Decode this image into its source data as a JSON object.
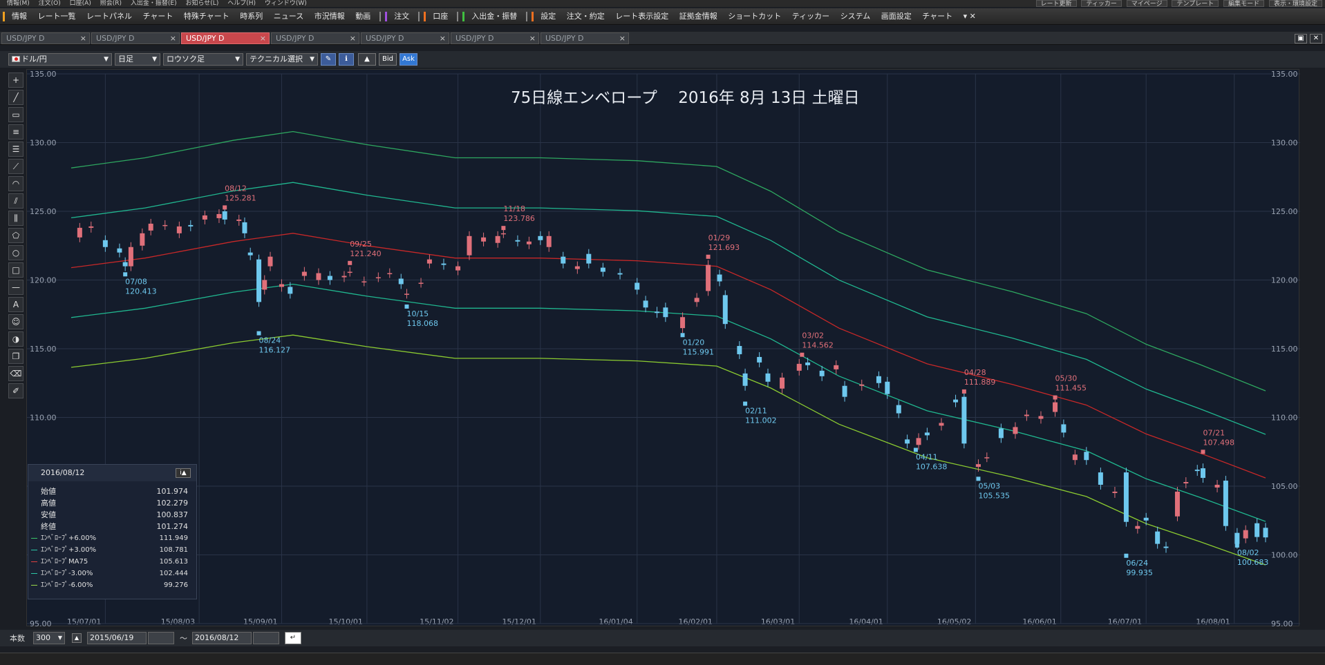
{
  "topbar": {
    "menu": [
      "情報(M)",
      "注文(O)",
      "口座(A)",
      "照会(R)",
      "入出金・振替(E)",
      "お知らせ(L)",
      "ヘルプ(H)",
      "ウィンドウ(W)"
    ],
    "right_buttons": [
      "レート更新",
      "ティッカー",
      "マイページ",
      "テンプレート",
      "編集モード",
      "表示・環境設定"
    ]
  },
  "menubar": {
    "items": [
      "情報",
      "レート一覧",
      "レートパネル",
      "チャート",
      "特殊チャート",
      "時系列",
      "ニュース",
      "市況情報",
      "動画",
      "注文",
      "口座",
      "入出金・振替",
      "設定",
      "注文・約定",
      "レート表示設定",
      "証拠金情報",
      "ショートカット",
      "ティッカー",
      "システム",
      "画面設定",
      "チャート"
    ],
    "overflow_icon": "▾ ✕"
  },
  "tabs": [
    {
      "label": "USD/JPY D",
      "active": false
    },
    {
      "label": "USD/JPY D",
      "active": false
    },
    {
      "label": "USD/JPY D",
      "active": true
    },
    {
      "label": "USD/JPY D",
      "active": false
    },
    {
      "label": "USD/JPY D",
      "active": false
    },
    {
      "label": "USD/JPY D",
      "active": false
    },
    {
      "label": "USD/JPY D",
      "active": false
    }
  ],
  "toolbar": {
    "pair": "ドル/円",
    "period": "日足",
    "chart_type": "ロウソク足",
    "technical": "テクニカル選択",
    "bid": "Bid",
    "ask": "Ask"
  },
  "left_tools": [
    "cursor-icon",
    "trendline-icon",
    "ruler-icon",
    "channel-icon",
    "fibonacci-icon",
    "fib-fan-icon",
    "fib-arc-icon",
    "gann-icon",
    "pitchfork-icon",
    "pentagon-icon",
    "circle-icon",
    "rectangle-icon",
    "hline-icon",
    "text-icon",
    "icon-icon",
    "paint-icon",
    "copy-icon",
    "eraser-icon",
    "settings-icon"
  ],
  "info_panel": {
    "date": "2016/08/12",
    "rows": [
      {
        "label": "始値",
        "value": "101.974"
      },
      {
        "label": "高値",
        "value": "102.279"
      },
      {
        "label": "安値",
        "value": "100.837"
      },
      {
        "label": "終値",
        "value": "101.274"
      },
      {
        "label": "ｴﾝﾍﾞﾛｰﾌﾟ+6.00%",
        "value": "111.949",
        "color": "#3ac86a"
      },
      {
        "label": "ｴﾝﾍﾞﾛｰﾌﾟ+3.00%",
        "value": "108.781",
        "color": "#2bc8a8"
      },
      {
        "label": "ｴﾝﾍﾞﾛｰﾌﾟMA75",
        "value": "105.613",
        "color": "#e04040"
      },
      {
        "label": "ｴﾝﾍﾞﾛｰﾌﾟ-3.00%",
        "value": "102.444",
        "color": "#2bc8a8"
      },
      {
        "label": "ｴﾝﾍﾞﾛｰﾌﾟ-6.00%",
        "value": "99.276",
        "color": "#9ad84a"
      }
    ]
  },
  "bottombar": {
    "count_label": "本数",
    "count": "300",
    "from": "2015/06/19",
    "tilde": "～",
    "to": "2016/08/12"
  },
  "colors": {
    "up": "#e0707a",
    "down": "#6ec8ee",
    "ma": "#c82828",
    "env3": "#20b890",
    "env6_up": "#2ea860",
    "env6_low": "#8ccc30"
  },
  "chart_data": {
    "type": "candlestick",
    "title": "75日線エンベロープ　 2016年 8月 13日 土曜日",
    "ylim": [
      95,
      135
    ],
    "yticks": [
      "135.00",
      "130.00",
      "125.00",
      "120.00",
      "115.00",
      "110.00",
      "105.00",
      "100.00",
      "95.00"
    ],
    "xticks": [
      "15/07/01",
      "15/08/03",
      "15/09/01",
      "15/10/01",
      "15/11/02",
      "15/12/01",
      "16/01/04",
      "16/02/01",
      "16/03/01",
      "16/04/01",
      "16/05/02",
      "16/06/01",
      "16/07/01",
      "16/08/01"
    ],
    "x_range": [
      "2015-06-19",
      "2016-08-12"
    ],
    "highs": [
      {
        "date": "08/12",
        "value": "125.281",
        "x": "2015-08-12",
        "y": 125.281
      },
      {
        "date": "09/25",
        "value": "121.240",
        "x": "2015-09-25",
        "y": 121.24
      },
      {
        "date": "11/18",
        "value": "123.786",
        "x": "2015-11-18",
        "y": 123.786
      },
      {
        "date": "01/29",
        "value": "121.693",
        "x": "2016-01-29",
        "y": 121.693
      },
      {
        "date": "03/02",
        "value": "114.562",
        "x": "2016-03-02",
        "y": 114.562
      },
      {
        "date": "04/28",
        "value": "111.889",
        "x": "2016-04-28",
        "y": 111.889
      },
      {
        "date": "05/30",
        "value": "111.455",
        "x": "2016-05-30",
        "y": 111.455
      },
      {
        "date": "07/21",
        "value": "107.498",
        "x": "2016-07-21",
        "y": 107.498
      }
    ],
    "lows": [
      {
        "date": "07/08",
        "value": "120.413",
        "x": "2015-07-08",
        "y": 120.413
      },
      {
        "date": "08/24",
        "value": "116.127",
        "x": "2015-08-24",
        "y": 116.127
      },
      {
        "date": "10/15",
        "value": "118.068",
        "x": "2015-10-15",
        "y": 118.068
      },
      {
        "date": "01/20",
        "value": "115.991",
        "x": "2016-01-20",
        "y": 115.991
      },
      {
        "date": "02/11",
        "value": "111.002",
        "x": "2016-02-11",
        "y": 111.002
      },
      {
        "date": "04/11",
        "value": "107.638",
        "x": "2016-04-11",
        "y": 107.638
      },
      {
        "date": "05/03",
        "value": "105.535",
        "x": "2016-05-03",
        "y": 105.535
      },
      {
        "date": "06/24",
        "value": "99.935",
        "x": "2016-06-24",
        "y": 99.935
      },
      {
        "date": "08/02",
        "value": "100.683",
        "x": "2016-08-02",
        "y": 100.683
      }
    ],
    "ma75": [
      [
        "2015-06-19",
        120.9
      ],
      [
        "2015-07-15",
        121.6
      ],
      [
        "2015-08-15",
        122.8
      ],
      [
        "2015-09-05",
        123.4
      ],
      [
        "2015-10-01",
        122.5
      ],
      [
        "2015-11-01",
        121.6
      ],
      [
        "2015-12-01",
        121.6
      ],
      [
        "2016-01-04",
        121.4
      ],
      [
        "2016-02-01",
        121.0
      ],
      [
        "2016-02-20",
        119.3
      ],
      [
        "2016-03-15",
        116.5
      ],
      [
        "2016-04-15",
        113.9
      ],
      [
        "2016-05-15",
        112.4
      ],
      [
        "2016-06-10",
        110.9
      ],
      [
        "2016-07-01",
        108.8
      ],
      [
        "2016-07-20",
        107.4
      ],
      [
        "2016-08-12",
        105.6
      ]
    ],
    "series": [
      {
        "name": "ｴﾝﾍﾞﾛｰﾌﾟ+6.00%",
        "factor": 1.06
      },
      {
        "name": "ｴﾝﾍﾞﾛｰﾌﾟ+3.00%",
        "factor": 1.03
      },
      {
        "name": "ｴﾝﾍﾞﾛｰﾌﾟMA75",
        "factor": 1.0
      },
      {
        "name": "ｴﾝﾍﾞﾛｰﾌﾟ-3.00%",
        "factor": 0.97
      },
      {
        "name": "ｴﾝﾍﾞﾛｰﾌﾟ-6.00%",
        "factor": 0.94
      }
    ],
    "candles": [
      [
        "2015-06-22",
        123.1,
        123.8
      ],
      [
        "2015-06-26",
        123.8,
        123.9
      ],
      [
        "2015-07-01",
        122.9,
        122.4
      ],
      [
        "2015-07-06",
        122.3,
        122.0
      ],
      [
        "2015-07-08",
        121.3,
        121.0
      ],
      [
        "2015-07-10",
        121.0,
        122.4
      ],
      [
        "2015-07-14",
        122.5,
        123.4
      ],
      [
        "2015-07-17",
        123.6,
        124.1
      ],
      [
        "2015-07-22",
        124.0,
        124.0
      ],
      [
        "2015-07-27",
        123.4,
        123.9
      ],
      [
        "2015-07-31",
        124.0,
        123.9
      ],
      [
        "2015-08-05",
        124.4,
        124.7
      ],
      [
        "2015-08-10",
        124.5,
        124.8
      ],
      [
        "2015-08-12",
        125.0,
        124.4
      ],
      [
        "2015-08-17",
        124.3,
        124.4
      ],
      [
        "2015-08-19",
        124.2,
        123.4
      ],
      [
        "2015-08-21",
        122.0,
        121.8
      ],
      [
        "2015-08-24",
        121.5,
        118.4
      ],
      [
        "2015-08-26",
        119.3,
        120.0
      ],
      [
        "2015-08-28",
        121.0,
        121.7
      ],
      [
        "2015-09-01",
        119.5,
        119.7
      ],
      [
        "2015-09-04",
        119.5,
        119.0
      ],
      [
        "2015-09-09",
        120.3,
        120.6
      ],
      [
        "2015-09-14",
        120.0,
        120.5
      ],
      [
        "2015-09-18",
        120.3,
        120.0
      ],
      [
        "2015-09-23",
        120.2,
        120.3
      ],
      [
        "2015-09-25",
        120.6,
        120.6
      ],
      [
        "2015-09-30",
        119.9,
        119.9
      ],
      [
        "2015-10-05",
        120.2,
        120.2
      ],
      [
        "2015-10-09",
        120.5,
        120.5
      ],
      [
        "2015-10-13",
        120.1,
        119.7
      ],
      [
        "2015-10-15",
        119.0,
        119.0
      ],
      [
        "2015-10-20",
        119.8,
        119.8
      ],
      [
        "2015-10-23",
        121.2,
        121.5
      ],
      [
        "2015-10-28",
        121.2,
        121.1
      ],
      [
        "2015-11-02",
        120.7,
        121.0
      ],
      [
        "2015-11-06",
        121.8,
        123.2
      ],
      [
        "2015-11-11",
        122.8,
        123.1
      ],
      [
        "2015-11-16",
        122.7,
        123.2
      ],
      [
        "2015-11-18",
        123.4,
        123.4
      ],
      [
        "2015-11-23",
        122.9,
        122.8
      ],
      [
        "2015-11-27",
        122.6,
        122.8
      ],
      [
        "2015-12-01",
        123.2,
        122.9
      ],
      [
        "2015-12-04",
        122.4,
        123.2
      ],
      [
        "2015-12-09",
        121.7,
        121.2
      ],
      [
        "2015-12-14",
        120.8,
        121.0
      ],
      [
        "2015-12-18",
        121.9,
        121.2
      ],
      [
        "2015-12-23",
        120.9,
        120.6
      ],
      [
        "2015-12-29",
        120.5,
        120.4
      ],
      [
        "2016-01-04",
        119.8,
        119.3
      ],
      [
        "2016-01-07",
        118.5,
        118.0
      ],
      [
        "2016-01-11",
        117.7,
        117.6
      ],
      [
        "2016-01-14",
        118.0,
        117.3
      ],
      [
        "2016-01-20",
        116.5,
        117.3
      ],
      [
        "2016-01-25",
        118.4,
        118.7
      ],
      [
        "2016-01-29",
        119.2,
        121.1
      ],
      [
        "2016-02-02",
        120.4,
        119.9
      ],
      [
        "2016-02-04",
        118.9,
        116.8
      ],
      [
        "2016-02-09",
        115.2,
        114.6
      ],
      [
        "2016-02-11",
        113.2,
        112.3
      ],
      [
        "2016-02-16",
        114.4,
        114.0
      ],
      [
        "2016-02-19",
        113.2,
        112.6
      ],
      [
        "2016-02-24",
        112.1,
        112.9
      ],
      [
        "2016-03-01",
        113.4,
        113.9
      ],
      [
        "2016-03-04",
        114.0,
        113.8
      ],
      [
        "2016-03-09",
        113.4,
        113.0
      ],
      [
        "2016-03-14",
        113.5,
        113.8
      ],
      [
        "2016-03-17",
        112.3,
        111.5
      ],
      [
        "2016-03-23",
        112.3,
        112.4
      ],
      [
        "2016-03-29",
        113.0,
        112.5
      ],
      [
        "2016-04-01",
        112.6,
        111.7
      ],
      [
        "2016-04-05",
        110.9,
        110.3
      ],
      [
        "2016-04-08",
        108.4,
        108.1
      ],
      [
        "2016-04-12",
        108.0,
        108.5
      ],
      [
        "2016-04-15",
        108.9,
        108.7
      ],
      [
        "2016-04-20",
        109.4,
        109.6
      ],
      [
        "2016-04-25",
        111.3,
        111.1
      ],
      [
        "2016-04-28",
        111.5,
        108.1
      ],
      [
        "2016-05-03",
        106.4,
        106.6
      ],
      [
        "2016-05-06",
        107.1,
        107.1
      ],
      [
        "2016-05-11",
        109.2,
        108.5
      ],
      [
        "2016-05-16",
        108.8,
        109.3
      ],
      [
        "2016-05-20",
        110.1,
        110.2
      ],
      [
        "2016-05-25",
        109.9,
        110.1
      ],
      [
        "2016-05-30",
        110.4,
        111.1
      ],
      [
        "2016-06-02",
        109.5,
        108.9
      ],
      [
        "2016-06-06",
        106.9,
        107.3
      ],
      [
        "2016-06-10",
        107.5,
        106.9
      ],
      [
        "2016-06-15",
        106.0,
        105.1
      ],
      [
        "2016-06-20",
        104.5,
        104.6
      ],
      [
        "2016-06-24",
        106.0,
        102.4
      ],
      [
        "2016-06-28",
        101.9,
        102.1
      ],
      [
        "2016-07-01",
        102.7,
        102.5
      ],
      [
        "2016-07-05",
        101.7,
        100.8
      ],
      [
        "2016-07-08",
        100.6,
        100.5
      ],
      [
        "2016-07-12",
        102.8,
        104.6
      ],
      [
        "2016-07-15",
        105.2,
        105.3
      ],
      [
        "2016-07-19",
        106.2,
        106.1
      ],
      [
        "2016-07-21",
        106.3,
        105.6
      ],
      [
        "2016-07-26",
        104.9,
        105.1
      ],
      [
        "2016-07-29",
        105.4,
        102.1
      ],
      [
        "2016-08-02",
        101.6,
        100.8
      ],
      [
        "2016-08-05",
        101.2,
        101.8
      ],
      [
        "2016-08-09",
        102.3,
        101.3
      ],
      [
        "2016-08-12",
        101.97,
        101.27
      ]
    ]
  }
}
